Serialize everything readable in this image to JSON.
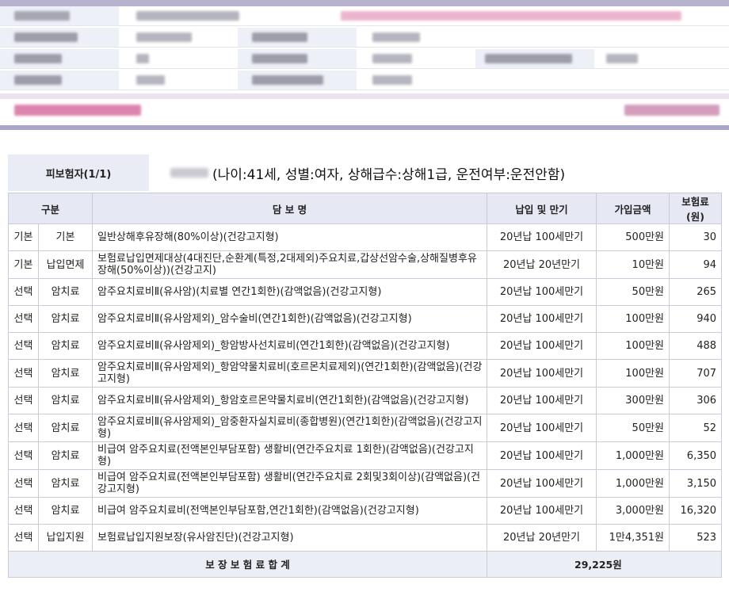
{
  "insured": {
    "label": "피보험자(1/1)",
    "info": "(나이:41세, 성별:여자, 상해급수:상해1급, 운전여부:운전안함)"
  },
  "table": {
    "headers": {
      "category": "구분",
      "coverage": "담 보 명",
      "term": "납입 및 만기",
      "amount": "가입금액",
      "premium": "보험료(원)"
    },
    "rows": [
      {
        "type": "기본",
        "sub": "기본",
        "name": "일반상해후유장해(80%이상)(건강고지형)",
        "term": "20년납 100세만기",
        "amount": "500만원",
        "premium": "30"
      },
      {
        "type": "기본",
        "sub": "납입면제",
        "name": "보험료납입면제대상(4대진단,순환계(특정,2대제외)주요치료,갑상선암수술,상해질병후유장해(50%이상))(건강고지)",
        "term": "20년납 20년만기",
        "amount": "10만원",
        "premium": "94"
      },
      {
        "type": "선택",
        "sub": "암치료",
        "name": "암주요치료비Ⅱ(유사암)(치료별 연간1회한)(감액없음)(건강고지형)",
        "term": "20년납 100세만기",
        "amount": "50만원",
        "premium": "265"
      },
      {
        "type": "선택",
        "sub": "암치료",
        "name": "암주요치료비Ⅱ(유사암제외)_암수술비(연간1회한)(감액없음)(건강고지형)",
        "term": "20년납 100세만기",
        "amount": "100만원",
        "premium": "940"
      },
      {
        "type": "선택",
        "sub": "암치료",
        "name": "암주요치료비Ⅱ(유사암제외)_항암방사선치료비(연간1회한)(감액없음)(건강고지형)",
        "term": "20년납 100세만기",
        "amount": "100만원",
        "premium": "488"
      },
      {
        "type": "선택",
        "sub": "암치료",
        "name": "암주요치료비Ⅱ(유사암제외)_항암약물치료비(호르몬치료제외)(연간1회한)(감액없음)(건강고지형)",
        "term": "20년납 100세만기",
        "amount": "100만원",
        "premium": "707"
      },
      {
        "type": "선택",
        "sub": "암치료",
        "name": "암주요치료비Ⅱ(유사암제외)_항암호르몬약물치료비(연간1회한)(감액없음)(건강고지형)",
        "term": "20년납 100세만기",
        "amount": "300만원",
        "premium": "306"
      },
      {
        "type": "선택",
        "sub": "암치료",
        "name": "암주요치료비Ⅱ(유사암제외)_암중환자실치료비(종합병원)(연간1회한)(감액없음)(건강고지형)",
        "term": "20년납 100세만기",
        "amount": "50만원",
        "premium": "52"
      },
      {
        "type": "선택",
        "sub": "암치료",
        "name": "비급여 암주요치료(전액본인부담포함) 생활비(연간주요치료 1회한)(감액없음)(건강고지형)",
        "term": "20년납 100세만기",
        "amount": "1,000만원",
        "premium": "6,350"
      },
      {
        "type": "선택",
        "sub": "암치료",
        "name": "비급여 암주요치료(전액본인부담포함) 생활비(연간주요치료 2회및3회이상)(감액없음)(건강고지형)",
        "term": "20년납 100세만기",
        "amount": "1,000만원",
        "premium": "3,150"
      },
      {
        "type": "선택",
        "sub": "암치료",
        "name": "비급여 암주요치료비(전액본인부담포함,연간1회한)(감액없음)(건강고지형)",
        "term": "20년납 100세만기",
        "amount": "3,000만원",
        "premium": "16,320"
      },
      {
        "type": "선택",
        "sub": "납입지원",
        "name": "보험료납입지원보장(유사암진단)(건강고지형)",
        "term": "20년납 20년만기",
        "amount": "1만4,351원",
        "premium": "523"
      }
    ],
    "total": {
      "label": "보 장 보 험 료 합 계",
      "value": "29,225원"
    }
  }
}
